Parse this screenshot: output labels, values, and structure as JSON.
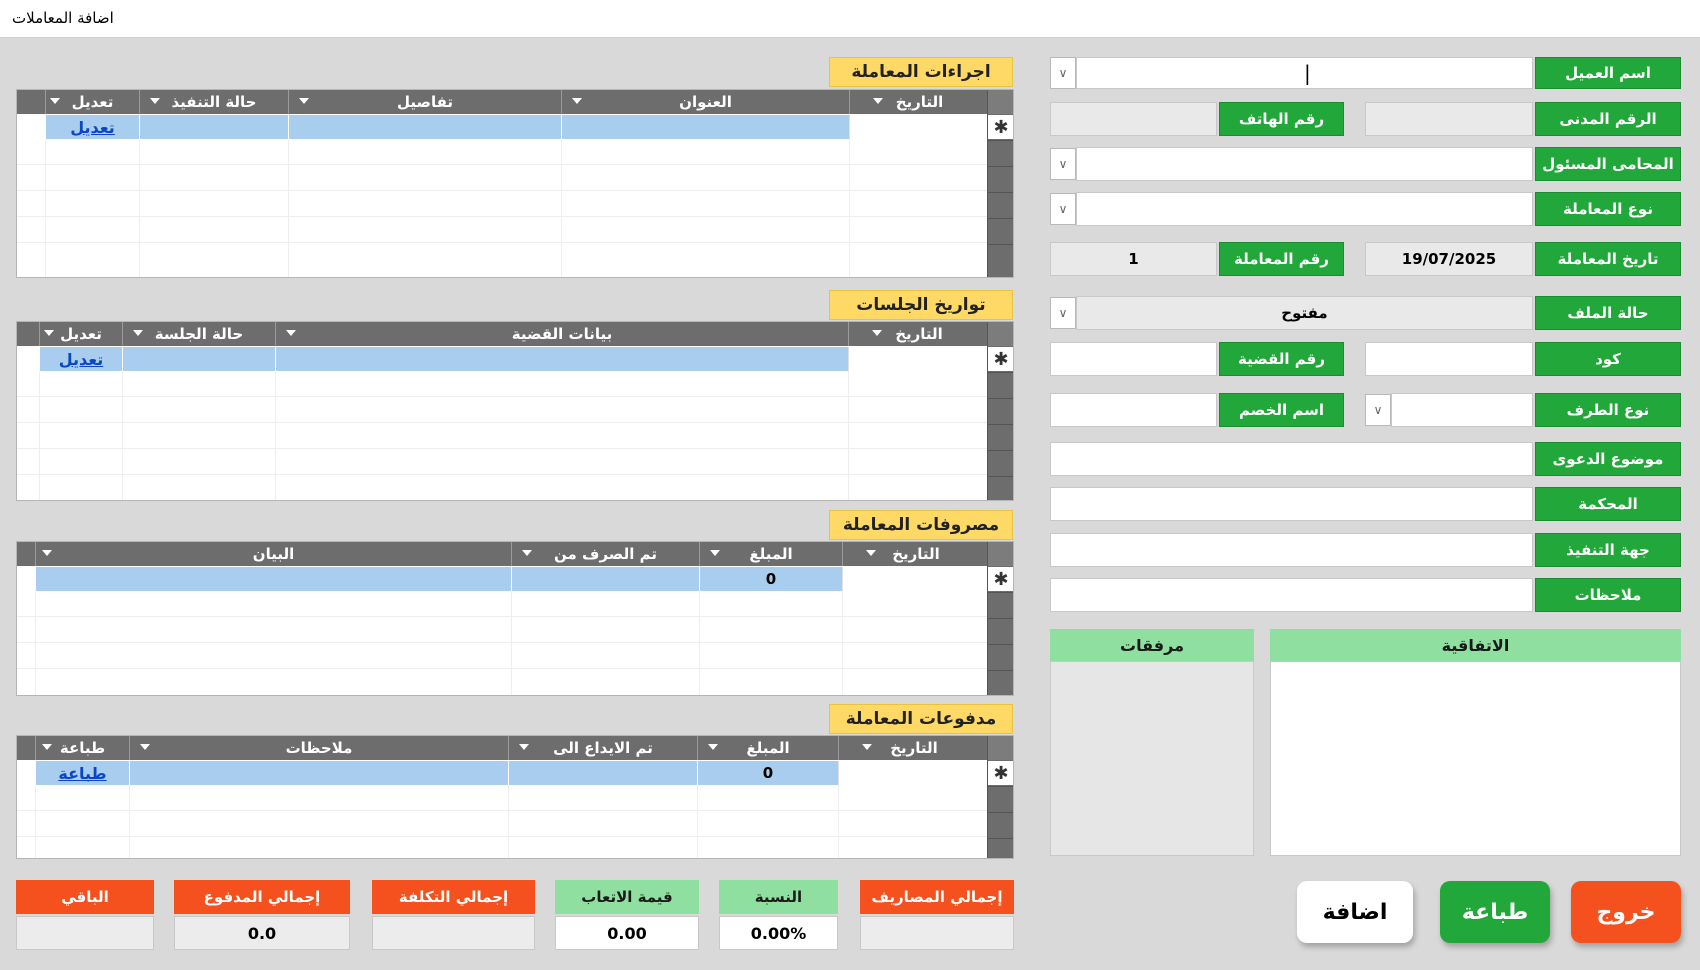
{
  "window": {
    "title": "اضافة المعاملات"
  },
  "form": {
    "client_name_label": "اسم العميل",
    "civil_id_label": "الرقم المدنى",
    "phone_label": "رقم الهاتف",
    "lawyer_label": "المحامى المسئول",
    "type_label": "نوع المعاملة",
    "date_label": "تاريخ المعاملة",
    "date_value": "19/07/2025",
    "number_label": "رقم المعاملة",
    "number_value": "1",
    "file_status_label": "حالة الملف",
    "file_status_value": "مفتوح",
    "code_label": "كود",
    "case_no_label": "رقم القضية",
    "party_type_label": "نوع الطرف",
    "opponent_label": "اسم الخصم",
    "subject_label": "موضوع الدعوى",
    "court_label": "المحكمة",
    "exec_label": "جهة التنفيذ",
    "notes_label": "ملاحظات",
    "agreement_label": "الاتفاقية",
    "attachments_label": "مرفقات"
  },
  "procedures": {
    "title": "اجراءات المعاملة",
    "columns": [
      "التاريخ",
      "العنوان",
      "تفاصيل",
      "حالة التنفيذ",
      "تعديل"
    ],
    "edit_link": "تعديل"
  },
  "sessions": {
    "title": "تواريخ الجلسات",
    "columns": [
      "التاريخ",
      "بيانات القضية",
      "حالة الجلسة",
      "تعديل"
    ],
    "edit_link": "تعديل"
  },
  "expenses": {
    "title": "مصروفات المعاملة",
    "columns": [
      "التاريخ",
      "المبلغ",
      "تم الصرف من",
      "البيان"
    ],
    "amount_value": "0"
  },
  "payments": {
    "title": "مدفوعات المعاملة",
    "columns": [
      "التاريخ",
      "المبلغ",
      "تم الايداع الى",
      "ملاحظات",
      "طباعة"
    ],
    "amount_value": "0",
    "print_link": "طباعة"
  },
  "summary": {
    "total_expenses_label": "إجمالي المصاريف",
    "ratio_label": "النسبة",
    "ratio_value": "0.00%",
    "fees_label": "قيمة الاتعاب",
    "fees_value": "0.00",
    "total_cost_label": "إجمالي التكلفة",
    "total_paid_label": "إجمالي المدفوع",
    "total_paid_value": "0.0",
    "remaining_label": "الباقي"
  },
  "buttons": {
    "exit": "خروج",
    "print": "طباعة",
    "add": "اضافة"
  },
  "colors": {
    "green": "#22a83a",
    "light_green": "#8fe0a0",
    "orange": "#f4511e",
    "yellow": "#ffd966",
    "header_gray": "#6d6d6d",
    "row_blue": "#a9cdee"
  }
}
